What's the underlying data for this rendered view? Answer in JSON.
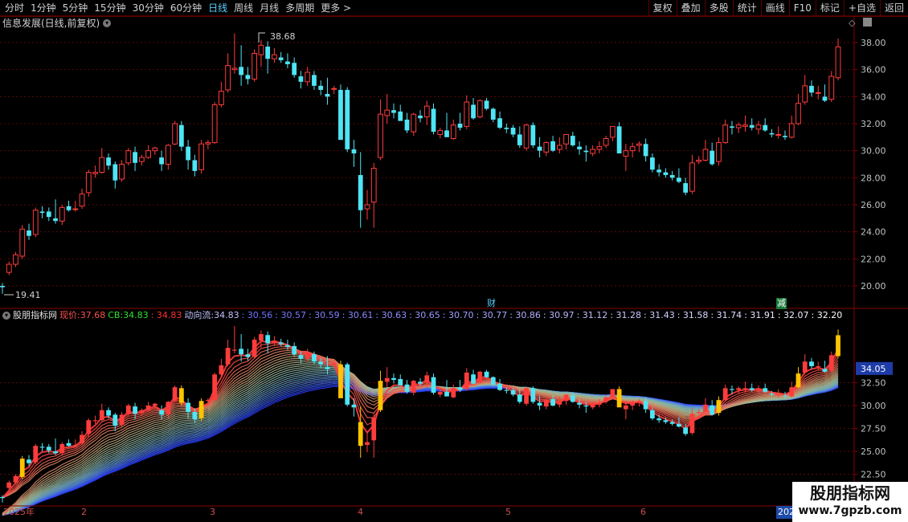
{
  "toolbar": {
    "periods": [
      "分时",
      "1分钟",
      "5分钟",
      "15分钟",
      "30分钟",
      "60分钟",
      "日线",
      "周线",
      "月线",
      "多周期",
      "更多 >"
    ],
    "active_period": "日线",
    "buttons": [
      "复权",
      "叠加",
      "多股",
      "统计",
      "画线",
      "F10",
      "标记",
      "+自选",
      "返回"
    ]
  },
  "main_panel": {
    "title": "信息发展(日线,前复权)",
    "max_label": "38.68",
    "min_label": "19.41",
    "y_ticks": [
      "38.00",
      "36.00",
      "34.00",
      "32.00",
      "30.00",
      "28.00",
      "26.00",
      "24.00",
      "22.00",
      "20.00"
    ],
    "markers": {
      "cai": "财",
      "jian": "减"
    }
  },
  "indicator_panel": {
    "name": "股朋指标网",
    "price_label": "现价:",
    "price_value": "37.68",
    "cb_label": "CB:",
    "cb_value": "34.83",
    "cb_value2": ": 34.83",
    "flow_label": "动向流:",
    "flow_value": "34.83",
    "flow_values": [
      ": 30.56",
      ": 30.57",
      ": 30.59",
      ": 30.61",
      ": 30.63",
      ": 30.65",
      ": 30.70",
      ": 30.77",
      ": 30.86",
      ": 30.97",
      ": 31.12",
      ": 31.28",
      ": 31.43",
      ": 31.58",
      ": 31.74",
      ": 31.91",
      ": 32.07",
      ": 32.20"
    ],
    "y_ticks": [
      "32.50",
      "30.00",
      "27.50",
      "25.00",
      "22.50"
    ],
    "current_tag": "34.05"
  },
  "date_axis": {
    "labels": [
      "2025年",
      "2",
      "3",
      "4",
      "5",
      "6",
      "202"
    ]
  },
  "watermark": {
    "line1": "股朋指标网",
    "line2": "www.7gpzb.com"
  },
  "colors": {
    "up": "#ff3c3c",
    "down": "#4ee5f5",
    "grid": "#5a0a0a",
    "axis": "#8a0000",
    "label": "#c0c0c0"
  },
  "chart_data": {
    "type": "candlestick",
    "ylim_main": [
      19.0,
      39.5
    ],
    "ylim_indicator": [
      21.5,
      36.0
    ],
    "ohlc": [
      [
        20.0,
        20.2,
        19.41,
        19.9
      ],
      [
        21.0,
        21.8,
        20.8,
        21.6
      ],
      [
        21.6,
        22.5,
        21.4,
        22.3
      ],
      [
        22.2,
        24.5,
        22.0,
        24.2
      ],
      [
        24.1,
        24.6,
        23.4,
        23.7
      ],
      [
        23.8,
        25.8,
        23.6,
        25.6
      ],
      [
        25.5,
        25.9,
        25.0,
        25.4
      ],
      [
        25.5,
        25.8,
        24.8,
        25.1
      ],
      [
        25.0,
        26.4,
        24.6,
        24.8
      ],
      [
        24.8,
        26.0,
        24.5,
        25.8
      ],
      [
        25.9,
        26.3,
        25.5,
        25.6
      ],
      [
        25.7,
        26.3,
        25.5,
        25.7
      ],
      [
        25.9,
        27.2,
        25.7,
        26.8
      ],
      [
        26.9,
        28.6,
        26.6,
        28.4
      ],
      [
        28.3,
        28.9,
        28.0,
        28.4
      ],
      [
        28.4,
        30.2,
        28.3,
        29.5
      ],
      [
        29.5,
        29.8,
        28.6,
        28.9
      ],
      [
        29.0,
        29.2,
        27.2,
        27.8
      ],
      [
        27.9,
        29.3,
        27.7,
        29.0
      ],
      [
        29.1,
        30.2,
        28.9,
        30.0
      ],
      [
        29.9,
        30.3,
        28.5,
        29.1
      ],
      [
        29.2,
        29.7,
        28.9,
        29.5
      ],
      [
        29.5,
        30.4,
        29.4,
        30.0
      ],
      [
        30.0,
        30.3,
        29.7,
        30.2
      ],
      [
        29.5,
        30.0,
        28.5,
        29.0
      ],
      [
        29.0,
        30.5,
        28.6,
        30.4
      ],
      [
        30.5,
        32.2,
        30.4,
        32.0
      ],
      [
        31.9,
        32.2,
        30.0,
        30.3
      ],
      [
        30.3,
        30.8,
        28.6,
        29.3
      ],
      [
        29.3,
        29.7,
        28.1,
        28.5
      ],
      [
        28.6,
        30.8,
        28.3,
        30.5
      ],
      [
        30.5,
        30.8,
        30.1,
        30.6
      ],
      [
        30.6,
        33.6,
        30.5,
        33.4
      ],
      [
        33.4,
        35.1,
        33.2,
        34.4
      ],
      [
        34.5,
        37.2,
        34.3,
        36.3
      ],
      [
        36.0,
        38.68,
        35.7,
        36.1
      ],
      [
        36.2,
        37.8,
        34.8,
        35.6
      ],
      [
        35.6,
        36.2,
        34.9,
        35.3
      ],
      [
        35.3,
        37.5,
        35.1,
        37.2
      ],
      [
        37.1,
        38.2,
        36.2,
        37.8
      ],
      [
        37.7,
        38.1,
        35.7,
        36.8
      ],
      [
        36.8,
        37.6,
        36.5,
        37.1
      ],
      [
        36.9,
        37.3,
        36.5,
        36.7
      ],
      [
        36.6,
        37.2,
        36.1,
        36.4
      ],
      [
        36.5,
        36.9,
        35.4,
        35.6
      ],
      [
        35.5,
        35.9,
        34.6,
        35.1
      ],
      [
        35.1,
        36.2,
        34.8,
        35.8
      ],
      [
        35.6,
        35.9,
        34.5,
        34.8
      ],
      [
        34.8,
        35.2,
        34.1,
        34.5
      ],
      [
        34.2,
        35.4,
        33.4,
        34.0
      ],
      [
        34.6,
        34.8,
        34.2,
        34.6
      ],
      [
        34.5,
        34.9,
        31.9,
        30.8
      ],
      [
        34.5,
        34.7,
        29.9,
        30.1
      ],
      [
        30.1,
        30.8,
        28.8,
        29.8
      ],
      [
        28.2,
        29.9,
        24.3,
        25.6
      ],
      [
        25.7,
        27.1,
        24.9,
        26.0
      ],
      [
        26.2,
        29.1,
        24.3,
        28.7
      ],
      [
        29.5,
        33.8,
        29.3,
        32.7
      ],
      [
        32.6,
        34.2,
        32.0,
        33.0
      ],
      [
        33.0,
        33.5,
        32.4,
        32.8
      ],
      [
        32.9,
        33.4,
        32.3,
        32.2
      ],
      [
        32.3,
        32.8,
        31.3,
        31.5
      ],
      [
        31.4,
        32.8,
        31.1,
        32.7
      ],
      [
        32.6,
        33.0,
        32.1,
        32.4
      ],
      [
        32.5,
        33.7,
        31.9,
        33.3
      ],
      [
        33.1,
        33.5,
        31.2,
        31.4
      ],
      [
        31.2,
        31.7,
        30.9,
        31.5
      ],
      [
        31.5,
        32.8,
        31.0,
        31.0
      ],
      [
        30.9,
        32.3,
        30.8,
        31.9
      ],
      [
        32.0,
        32.8,
        31.5,
        31.7
      ],
      [
        31.8,
        34.1,
        31.6,
        33.6
      ],
      [
        33.4,
        33.9,
        32.3,
        32.4
      ],
      [
        32.5,
        33.8,
        32.4,
        33.7
      ],
      [
        33.7,
        33.9,
        33.0,
        33.1
      ],
      [
        33.1,
        33.2,
        32.1,
        32.3
      ],
      [
        32.4,
        32.9,
        31.6,
        31.7
      ],
      [
        31.7,
        32.0,
        31.3,
        31.6
      ],
      [
        31.7,
        31.9,
        31.0,
        31.2
      ],
      [
        31.2,
        31.8,
        30.2,
        30.4
      ],
      [
        30.2,
        32.0,
        30.0,
        31.9
      ],
      [
        31.9,
        32.1,
        30.2,
        30.4
      ],
      [
        30.3,
        31.0,
        29.5,
        30.0
      ],
      [
        29.9,
        30.7,
        29.6,
        30.6
      ],
      [
        30.7,
        31.1,
        29.9,
        30.0
      ],
      [
        30.1,
        31.0,
        29.8,
        30.4
      ],
      [
        30.5,
        31.2,
        30.1,
        31.2
      ],
      [
        31.1,
        31.4,
        30.3,
        30.4
      ],
      [
        30.3,
        30.7,
        29.7,
        30.1
      ],
      [
        30.0,
        30.4,
        29.2,
        29.9
      ],
      [
        29.8,
        30.4,
        29.6,
        30.1
      ],
      [
        30.1,
        30.7,
        29.8,
        30.3
      ],
      [
        30.4,
        31.1,
        30.2,
        30.9
      ],
      [
        31.0,
        31.8,
        30.7,
        31.8
      ],
      [
        31.8,
        32.1,
        30.2,
        29.8
      ],
      [
        29.6,
        30.5,
        28.5,
        30.0
      ],
      [
        30.0,
        30.6,
        29.5,
        30.3
      ],
      [
        30.4,
        30.7,
        29.9,
        30.5
      ],
      [
        30.5,
        30.9,
        29.2,
        29.6
      ],
      [
        29.5,
        29.8,
        28.4,
        28.6
      ],
      [
        28.6,
        29.0,
        28.1,
        28.4
      ],
      [
        28.4,
        28.7,
        28.0,
        28.2
      ],
      [
        28.2,
        28.5,
        27.8,
        28.0
      ],
      [
        28.0,
        28.7,
        27.6,
        27.7
      ],
      [
        27.6,
        28.0,
        26.7,
        26.9
      ],
      [
        27.0,
        29.7,
        26.8,
        29.1
      ],
      [
        29.2,
        29.6,
        29.0,
        29.3
      ],
      [
        29.3,
        30.8,
        29.2,
        30.1
      ],
      [
        30.0,
        30.6,
        28.9,
        29.0
      ],
      [
        29.2,
        31.0,
        28.9,
        30.6
      ],
      [
        30.6,
        32.3,
        30.5,
        31.9
      ],
      [
        31.8,
        32.2,
        31.2,
        31.7
      ],
      [
        31.7,
        32.1,
        31.3,
        31.9
      ],
      [
        31.8,
        32.6,
        31.4,
        31.9
      ],
      [
        31.9,
        32.4,
        31.5,
        31.7
      ],
      [
        31.6,
        32.2,
        31.2,
        31.9
      ],
      [
        31.9,
        32.4,
        31.4,
        31.5
      ],
      [
        31.3,
        31.6,
        31.0,
        31.2
      ],
      [
        31.2,
        31.8,
        30.9,
        31.2
      ],
      [
        31.1,
        31.5,
        30.8,
        31.0
      ],
      [
        31.0,
        32.6,
        30.9,
        32.0
      ],
      [
        32.0,
        34.2,
        31.9,
        33.5
      ],
      [
        33.6,
        35.6,
        33.4,
        34.8
      ],
      [
        34.8,
        35.2,
        34.0,
        34.3
      ],
      [
        34.3,
        34.8,
        33.8,
        34.3
      ],
      [
        34.0,
        34.9,
        33.6,
        33.7
      ],
      [
        33.8,
        35.9,
        33.6,
        35.5
      ],
      [
        35.4,
        38.3,
        35.2,
        37.68
      ]
    ]
  }
}
